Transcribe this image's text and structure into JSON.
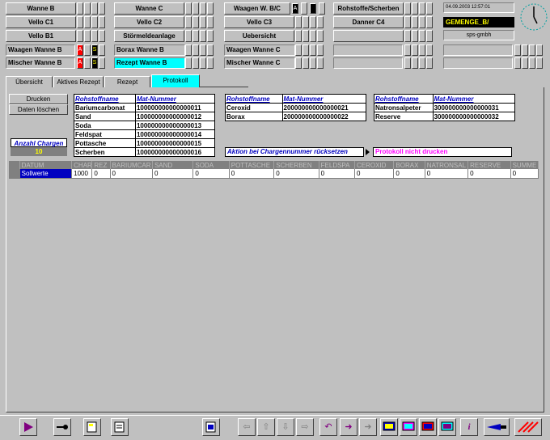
{
  "header": {
    "row1": [
      "Wanne B",
      "Wanne C",
      "Waagen W. B/C",
      "Rohstoffe/Scherben"
    ],
    "row2": [
      "Vello C1",
      "Vello C2",
      "Vello C3",
      "Danner C4"
    ],
    "row3": [
      "Vello B1",
      "Störmeldeanlage",
      "Uebersicht"
    ],
    "datetime": "04.09.2003 12:57:01",
    "gemenge": "GEMENGE_B/",
    "company": "sps-gmbh",
    "a_mark": "A"
  },
  "status": {
    "r1c1": "Waagen Wanne B",
    "r1c2": "Borax Wanne B",
    "r1c3": "Waagen Wanne C",
    "r2c1": "Mischer Wanne B",
    "r2c2": "Rezept Wanne B",
    "r2c3": "Mischer Wanne C",
    "badge_a": "A",
    "badge_s": "S"
  },
  "tabs": [
    "Übersicht",
    "Aktives Rezept",
    "Rezept",
    "Protokoll"
  ],
  "actions": {
    "print": "Drucken",
    "delete": "Daten löschen"
  },
  "charges": {
    "label": "Anzahl Chargen",
    "value": "10"
  },
  "tables": {
    "header": [
      "Rohstoffname",
      "Mat-Nummer"
    ],
    "t1": [
      [
        "Bariumcarbonat",
        "100000000000000011"
      ],
      [
        "Sand",
        "100000000000000012"
      ],
      [
        "Soda",
        "100000000000000013"
      ],
      [
        "Feldspat",
        "100000000000000014"
      ],
      [
        "Pottasche",
        "100000000000000015"
      ],
      [
        "Scherben",
        "100000000000000016"
      ]
    ],
    "t2": [
      [
        "Ceroxid",
        "200000000000000021"
      ],
      [
        "Borax",
        "200000000000000022"
      ]
    ],
    "t3": [
      [
        "Natronsalpeter",
        "300000000000000031"
      ],
      [
        "Reserve",
        "300000000000000032"
      ]
    ]
  },
  "options": {
    "reset": "Aktion bei Chargennummer rücksetzen",
    "noprint": "Protokoll nicht drucken"
  },
  "grid": {
    "columns": [
      "DATUM",
      "CHAR",
      "REZ",
      "BARIUMCAR",
      "SAND",
      "SODA",
      "POTTASCHE",
      "SCHERBEN",
      "FELDSPA",
      "CEROXID",
      "BORAX",
      "NATRONSAL",
      "RESERVE",
      "SUMME"
    ],
    "row_label": "Sollwerte",
    "values": [
      "1000",
      "0",
      "0",
      "0",
      "0",
      "0",
      "0",
      "0",
      "0",
      "0",
      "0",
      "0",
      "0"
    ]
  },
  "colors": {
    "accent_cyan": "#00ffff",
    "yellow": "#ffff00",
    "navy": "#0000c0",
    "magenta": "#ff00ff"
  }
}
